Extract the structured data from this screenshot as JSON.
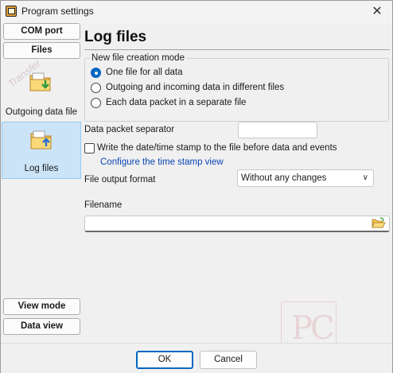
{
  "window": {
    "title": "Program settings",
    "app_icon": "serial-port-icon",
    "close_glyph": "✕"
  },
  "sidebar": {
    "top_buttons": [
      {
        "label": "COM port"
      },
      {
        "label": "Files"
      }
    ],
    "icon_items": [
      {
        "label": "Outgoing data file",
        "icon": "folder-download-icon"
      },
      {
        "label": "Log files",
        "icon": "folder-upload-icon",
        "selected": true
      }
    ],
    "bottom_buttons": [
      {
        "label": "View mode"
      },
      {
        "label": "Data view"
      }
    ],
    "watermark": "Transfer"
  },
  "main": {
    "title": "Log files",
    "creation_mode": {
      "legend": "New file creation mode",
      "options": [
        {
          "label": "One file for all data",
          "checked": true
        },
        {
          "label": "Outgoing and incoming data in different files",
          "checked": false
        },
        {
          "label": "Each data packet in a separate file",
          "checked": false
        }
      ]
    },
    "separator": {
      "label": "Data packet separator",
      "value": ""
    },
    "timestamp": {
      "label": "Write the date/time stamp to the file before data and events",
      "checked": false
    },
    "timestamp_link": "Configure the time stamp view",
    "output_format": {
      "label": "File output format",
      "selected": "Without any changes"
    },
    "filename": {
      "label": "Filename",
      "value": ""
    }
  },
  "footer": {
    "ok_label": "OK",
    "cancel_label": "Cancel"
  },
  "colors": {
    "accent": "#0067c0",
    "selected_bg": "#cce4f7",
    "link": "#0a45b5"
  }
}
